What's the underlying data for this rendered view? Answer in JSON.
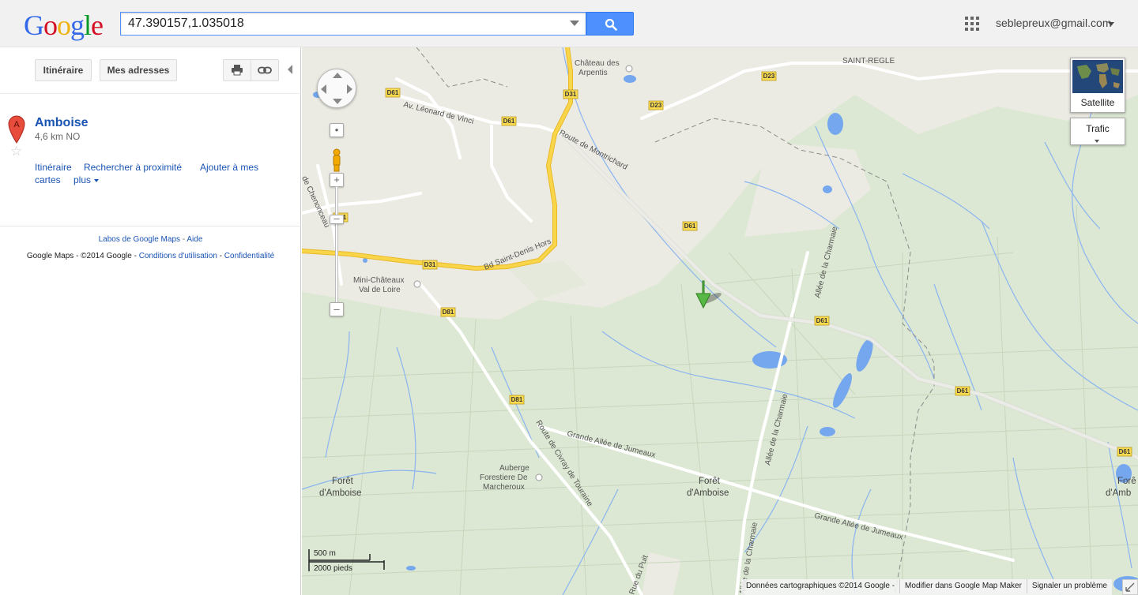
{
  "header": {
    "logo_text": "Google",
    "search_value": "47.390157,1.035018",
    "search_button_icon": "search-icon",
    "apps_icon": "grid-icon",
    "account": "seblepreux@gmail.com"
  },
  "toolbar": {
    "itinerary_label": "Itinéraire",
    "my_places_label": "Mes adresses",
    "print_icon": "printer-icon",
    "link_icon": "link-icon",
    "collapse_icon": "collapse-arrow-icon"
  },
  "result": {
    "marker_letter": "A",
    "name": "Amboise",
    "distance": "4,6 km NO",
    "links": {
      "itinerary": "Itinéraire",
      "nearby": "Rechercher à proximité",
      "add_to_maps_1": "Ajouter à mes",
      "add_to_maps_2": "cartes",
      "more": "plus"
    }
  },
  "footer": {
    "labs": "Labos de Google Maps",
    "sep": " - ",
    "help": "Aide",
    "copyright": "Google Maps - ©2014 Google - ",
    "terms": "Conditions d'utilisation",
    "privacy": "Confidentialité"
  },
  "map": {
    "layers": {
      "satellite": "Satellite",
      "traffic": "Trafic"
    },
    "scale": {
      "metric": "500 m",
      "imperial": "2000 pieds"
    },
    "bottom": {
      "data": "Données cartographiques ©2014 Google -",
      "edit": "Modifier dans Google Map Maker",
      "report": "Signaler un problème"
    },
    "labels": {
      "chateau_1": "Château des",
      "chateau_2": "Arpentis",
      "saint_regle": "SAINT-REGLE",
      "av_leonard": "Av. Léonard de Vinci",
      "route_montrichard": "Route de Montrichard",
      "de_chenonceau": "de Chenonceau",
      "bd_saint_denis": "Bd Saint-Denis Hors",
      "mini_1": "Mini-Châteaux",
      "mini_2": "Val de Loire",
      "allee_charmaie": "Allée de la Charmaie",
      "route_civray": "Route de Civray de Touraine",
      "grande_allee": "Grande Allée de Jumeaux",
      "auberge_1": "Auberge",
      "auberge_2": "Forestiere De",
      "auberge_3": "Marcheroux",
      "foret_1": "Forêt",
      "foret_2": "d'Amboise",
      "rue_puit": "Rue du Puit",
      "foret_edge_1": "Forê",
      "foret_edge_2": "d'Amb"
    },
    "shields": {
      "d61": "D61",
      "d31": "D31",
      "d23": "D23",
      "d81": "D81"
    },
    "colors": {
      "forest": "#cfe0c3",
      "urban": "#ecebe3",
      "water": "#75a7ee",
      "highway": "#f9d54a",
      "road": "#ffffff",
      "marker": "#57b845"
    }
  }
}
